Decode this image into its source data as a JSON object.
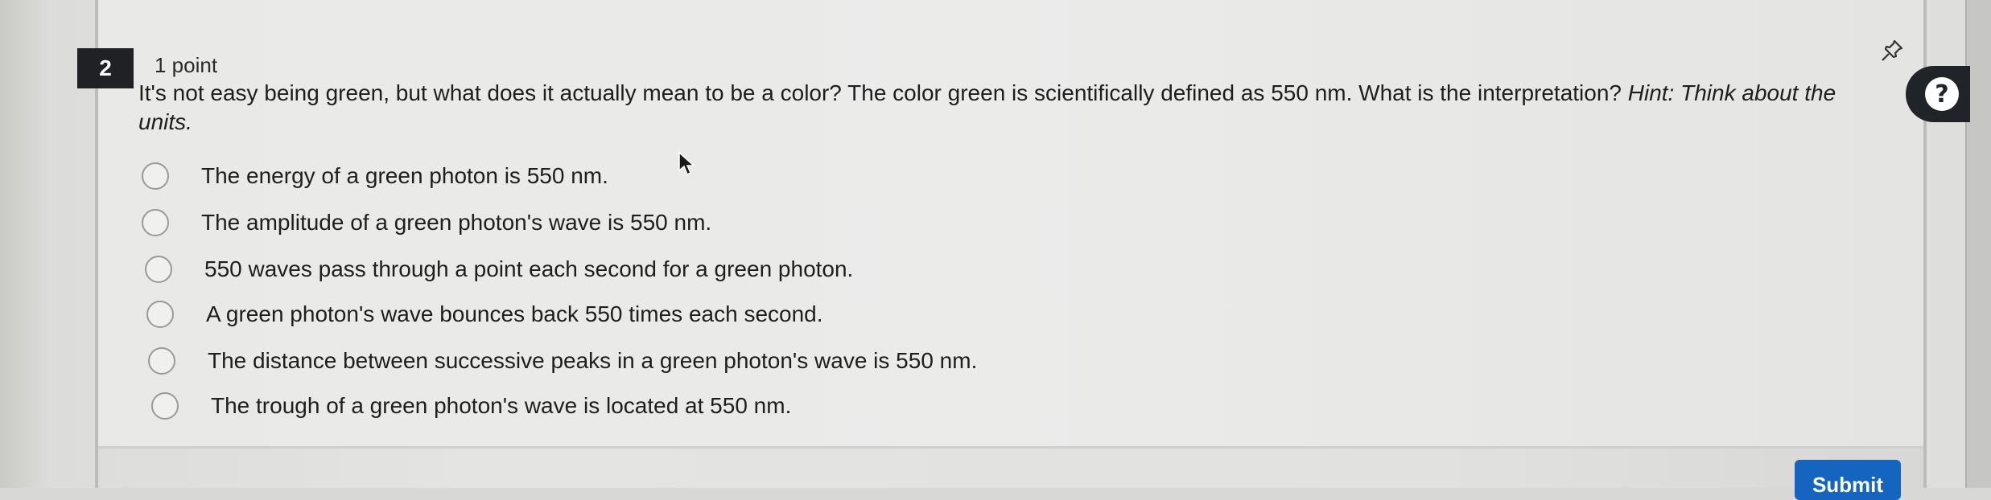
{
  "question": {
    "number": "2",
    "points": "1 point",
    "text": "It's not easy being green, but what does it actually mean to be a color? The color green is scientifically defined as 550 nm. What is the interpretation? ",
    "hint": "Hint: Think about the units.",
    "options": [
      "The energy of a green photon is 550 nm.",
      "The amplitude of a green photon's wave is 550 nm.",
      "550 waves pass through a point each second for a green photon.",
      "A green photon's wave bounces back 550 times each second.",
      "The distance between successive peaks in a green photon's wave is 550 nm.",
      "The trough of a green photon's wave is located at 550 nm."
    ]
  },
  "help": {
    "label": "?",
    "icon": "question-mark-icon"
  },
  "pin": {
    "icon": "pin-icon"
  },
  "submit": {
    "label": "Submit"
  },
  "colors": {
    "accent": "#1565c0",
    "dark_badge": "#1f2124"
  }
}
